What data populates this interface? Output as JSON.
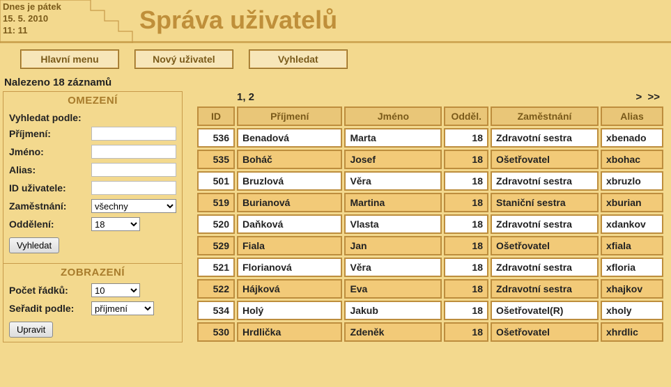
{
  "header": {
    "date_line1": "Dnes je pátek",
    "date_line2": "15. 5. 2010",
    "time": "11: 11",
    "title": "Správa uživatelů"
  },
  "menu": {
    "main": "Hlavní menu",
    "new_user": "Nový uživatel",
    "search": "Vyhledat"
  },
  "results_label": "Nalezeno 18 záznamů",
  "filter": {
    "header": "OMEZENÍ",
    "search_by": "Vyhledat podle:",
    "prijmeni": "Příjmení:",
    "jmeno": "Jméno:",
    "alias": "Alias:",
    "id_uzivatele": "ID uživatele:",
    "zamestnani": "Zaměstnání:",
    "zamestnani_value": "všechny",
    "oddeleni": "Oddělení:",
    "oddeleni_value": "18",
    "button": "Vyhledat"
  },
  "display": {
    "header": "ZOBRAZENÍ",
    "pocet_radku": "Počet řádků:",
    "pocet_radku_value": "10",
    "seradit_podle": "Seřadit podle:",
    "seradit_podle_value": "příjmení",
    "button": "Upravit"
  },
  "pager": {
    "pages": "1, 2",
    "next": ">",
    "last": ">>"
  },
  "table": {
    "headers": {
      "id": "ID",
      "prijmeni": "Příjmení",
      "jmeno": "Jméno",
      "oddel": "Odděl.",
      "zamestnani": "Zaměstnání",
      "alias": "Alias"
    },
    "rows": [
      {
        "id": "536",
        "prijmeni": "Benadová",
        "jmeno": "Marta",
        "oddel": "18",
        "zamestnani": "Zdravotní sestra",
        "alias": "xbenado"
      },
      {
        "id": "535",
        "prijmeni": "Boháč",
        "jmeno": "Josef",
        "oddel": "18",
        "zamestnani": "Ošetřovatel",
        "alias": "xbohac"
      },
      {
        "id": "501",
        "prijmeni": "Bruzlová",
        "jmeno": "Věra",
        "oddel": "18",
        "zamestnani": "Zdravotní sestra",
        "alias": "xbruzlo"
      },
      {
        "id": "519",
        "prijmeni": "Burianová",
        "jmeno": "Martina",
        "oddel": "18",
        "zamestnani": "Staniční sestra",
        "alias": "xburian"
      },
      {
        "id": "520",
        "prijmeni": "Daňková",
        "jmeno": "Vlasta",
        "oddel": "18",
        "zamestnani": "Zdravotní sestra",
        "alias": "xdankov"
      },
      {
        "id": "529",
        "prijmeni": "Fiala",
        "jmeno": "Jan",
        "oddel": "18",
        "zamestnani": "Ošetřovatel",
        "alias": "xfiala"
      },
      {
        "id": "521",
        "prijmeni": "Florianová",
        "jmeno": "Věra",
        "oddel": "18",
        "zamestnani": "Zdravotní sestra",
        "alias": "xfloria"
      },
      {
        "id": "522",
        "prijmeni": "Hájková",
        "jmeno": "Eva",
        "oddel": "18",
        "zamestnani": "Zdravotní sestra",
        "alias": "xhajkov"
      },
      {
        "id": "534",
        "prijmeni": "Holý",
        "jmeno": "Jakub",
        "oddel": "18",
        "zamestnani": "Ošetřovatel(R)",
        "alias": "xholy"
      },
      {
        "id": "530",
        "prijmeni": "Hrdlička",
        "jmeno": "Zdeněk",
        "oddel": "18",
        "zamestnani": "Ošetřovatel",
        "alias": "xhrdlic"
      }
    ]
  }
}
